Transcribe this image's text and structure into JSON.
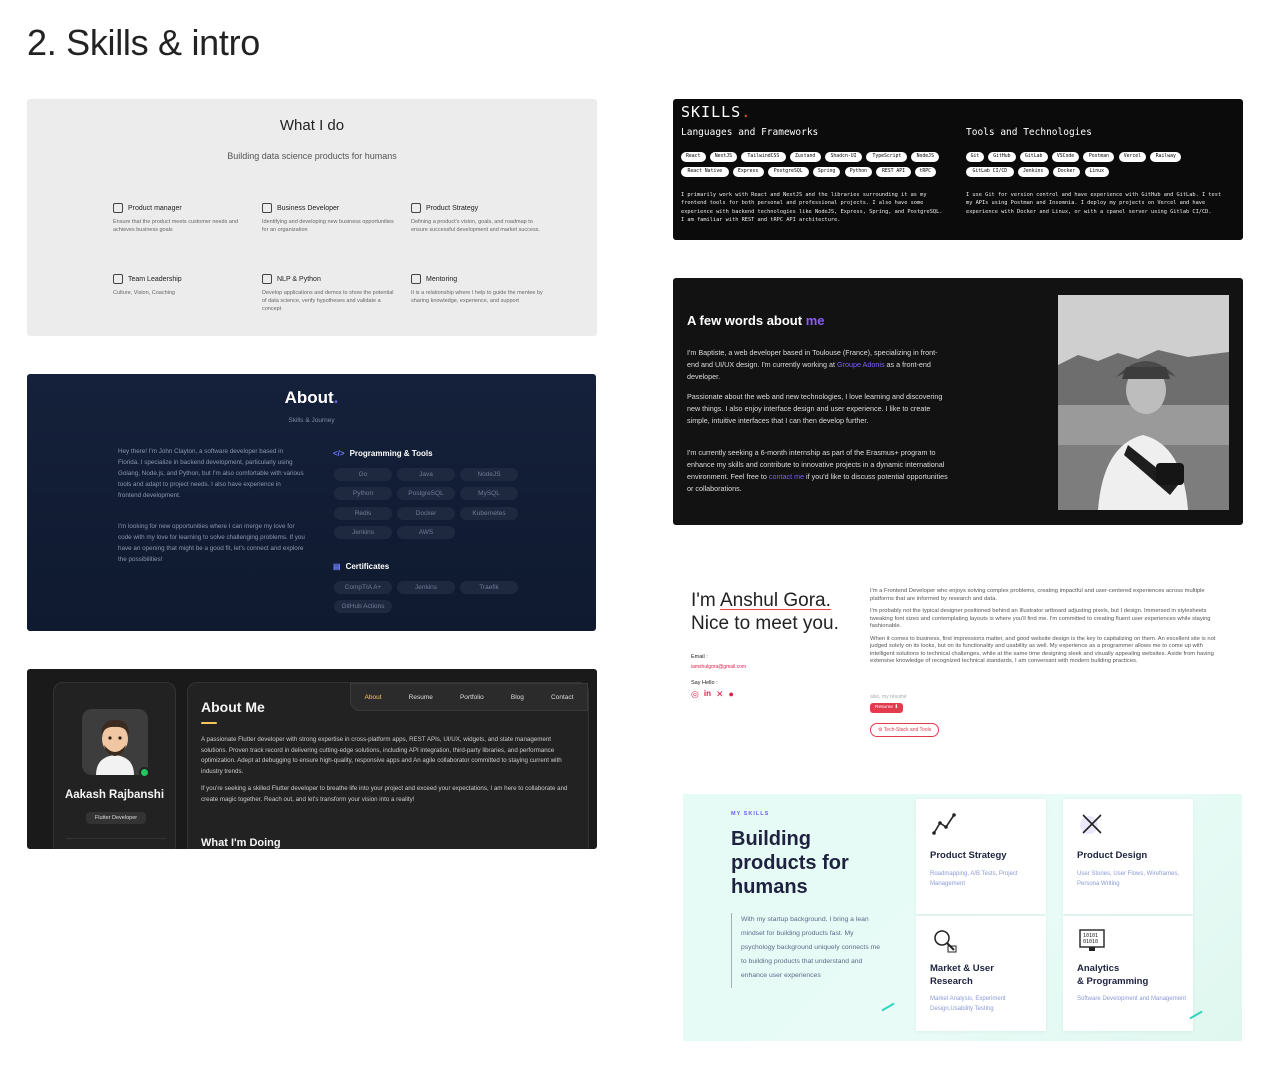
{
  "page_title": "2. Skills & intro",
  "whatido": {
    "title": "What I do",
    "subtitle": "Building data science products for humans",
    "items": [
      {
        "title": "Product manager",
        "desc": "Ensure that the product meets customer needs and achieves business goals",
        "icon": "lightbulb-icon"
      },
      {
        "title": "Business Developer",
        "desc": "Identifying and developing new business opportunities for an organization",
        "icon": "briefcase-icon"
      },
      {
        "title": "Product Strategy",
        "desc": "Defining a product's vision, goals, and roadmap to ensure successful development and market success.",
        "icon": "strategy-icon"
      },
      {
        "title": "Team Leadership",
        "desc": "Culture, Vision, Coaching",
        "icon": "team-icon"
      },
      {
        "title": "NLP & Python",
        "desc": "Develop applications and demos to show the potential of data science, verify hypotheses and validate a concept",
        "icon": "code-icon"
      },
      {
        "title": "Mentoring",
        "desc": "It is a relationship where I help to guide the mentee by sharing knowledge, experience, and support",
        "icon": "megaphone-icon"
      }
    ]
  },
  "about": {
    "title": "About",
    "dot": ".",
    "subtitle": "Skills & Journey",
    "para1": "Hey there! I'm John Clayton, a software developer based in Florida. I specialize in backend development, particularly using Golang, Node.js, and Python, but I'm also comfortable with various tools and adapt to project needs. I also have experience in frontend development.",
    "para2": "I'm looking for new opportunities where I can merge my love for code with my love for learning to solve challenging problems. If you have an opening that might be a good fit, let's connect and explore the possibilities!",
    "tools_heading": "Programming & Tools",
    "tools": [
      "Go",
      "Java",
      "NodeJS",
      "Python",
      "PostgreSQL",
      "MySQL",
      "Redis",
      "Docker",
      "Kubernetes",
      "Jenkins",
      "AWS"
    ],
    "cert_heading": "Certificates",
    "certs": [
      "CompTIA A+",
      "Jenkins",
      "Traefik",
      "GitHub Actions"
    ]
  },
  "aboutme": {
    "name": "Aakash Rajbanshi",
    "role": "Flutter Developer",
    "nav": [
      "About",
      "Resume",
      "Portfolio",
      "Blog",
      "Contact"
    ],
    "title": "About Me",
    "para1": "A passionate Flutter developer with strong expertise in cross-platform apps, REST APIs, UI/UX, widgets, and state management solutions. Proven track record in delivering cutting-edge solutions, including API integration, third-party libraries, and performance optimization. Adept at debugging to ensure high-quality, responsive apps and An agile collaborator committed to staying current with industry trends.",
    "para2": "If you're seeking a skilled Flutter developer to breathe life into your project and exceed your expectations, I am here to collaborate and create magic together. Reach out, and let's transform your vision into a reality!",
    "doing": "What I'm Doing"
  },
  "skills": {
    "title": "SKILLS",
    "dot": ".",
    "col1_heading": "Languages and Frameworks",
    "col1_chips": [
      "React",
      "NextJS",
      "TailwindCSS",
      "Zustand",
      "Shadcn-UI",
      "TypeScript",
      "NodeJS",
      "React Native",
      "Express",
      "PostgreSQL",
      "Spring",
      "Python",
      "REST API",
      "tRPC"
    ],
    "col1_text": "I primarily work with React and NextJS and the libraries surrounding it as my frontend tools for both personal and professional projects. I also have some experience with backend technologies like NodeJS, Express, Spring, and PostgreSQL. I am familiar with REST and tRPC API architecture.",
    "col2_heading": "Tools and Technologies",
    "col2_chips": [
      "Git",
      "GitHub",
      "GitLab",
      "VSCode",
      "Postman",
      "Vercel",
      "Railway",
      "GitLab CI/CD",
      "Jenkins",
      "Docker",
      "Linux"
    ],
    "col2_text": "I use Git for version control and have experience with GitHub and GitLab. I test my APIs using Postman and Insomnia. I deploy my projects on Vercel and have experience with Docker and Linux, or with a cpanel server using Gitlab CI/CD."
  },
  "words": {
    "title_a": "A few words about ",
    "title_b": "me",
    "p1a": "I'm Baptiste, a web developer based in Toulouse (France), specializing in front-end and UI/UX design. I'm currently working at ",
    "p1link": "Groupe Adonis",
    "p1b": " as a front-end developer.",
    "p2": "Passionate about the web and new technologies, I love learning and discovering new things. I also enjoy interface design and user experience. I like to create simple, intuitive interfaces that I can then develop further.",
    "p3a": "I'm currently seeking a 6-month internship as part of the Erasmus+ program to enhance my skills and contribute to innovative projects in a dynamic international environment. Feel free to ",
    "p3link": "contact me",
    "p3b": " if you'd like to discuss potential opportunities or collaborations."
  },
  "anshul": {
    "greet": "I'm ",
    "name": "Anshul Gora.",
    "line2": "Nice to meet you.",
    "email_label": "Email :",
    "email": "iamshulgora@gmail.com",
    "hello_label": "Say Hello :",
    "paras": [
      "I'm a Frontend Developer who enjoys solving complex problems, creating impactful and user-centered experiences across multiple platforms that are informed by research and data.",
      "I'm probably not the typical designer positioned behind an Illustrator artboard adjusting pixels, but I design. Immersed in stylesheets tweaking font sizes and contemplating layouts is where you'll find me. I'm committed to creating fluent user experiences while staying fashionable.",
      "When it comes to business, first impressions matter, and good website design is the key to capitalizing on them. An excellent site is not judged solely on its looks, but on its functionality and usability as well. My experience as a programmer allows me to come up with intelligent solutions to technical challenges, while at the same time designing sleek and visually appealing websites. Aside from having extensive knowledge of recognized technical standards, I am conversant with modern building practices."
    ],
    "also": "also, my résumé",
    "resume": "Resume",
    "tech": "Tech-Stack and Tools"
  },
  "build": {
    "kicker": "MY SKILLS",
    "title_lines": [
      "Building",
      "products for",
      "humans"
    ],
    "para": "With my startup background, I bring a lean mindset for building products fast. My psychology background uniquely connects me to building products that understand and enhance user experiences",
    "cards": [
      {
        "title": "Product Strategy",
        "desc": "Roadmapping,  A/B Tests, Project Management",
        "icon": "chart-line-icon"
      },
      {
        "title": "Product Design",
        "desc": "User Stories, User Flows, Wireframes, Persona Writing",
        "icon": "design-tools-icon"
      },
      {
        "title": "Market & User\nResearch",
        "desc": "Market Analysis, Experiment Design,Usability Testing",
        "icon": "research-icon"
      },
      {
        "title": "Analytics\n& Programming",
        "desc": "Software Development and Management",
        "icon": "binary-monitor-icon"
      }
    ]
  }
}
